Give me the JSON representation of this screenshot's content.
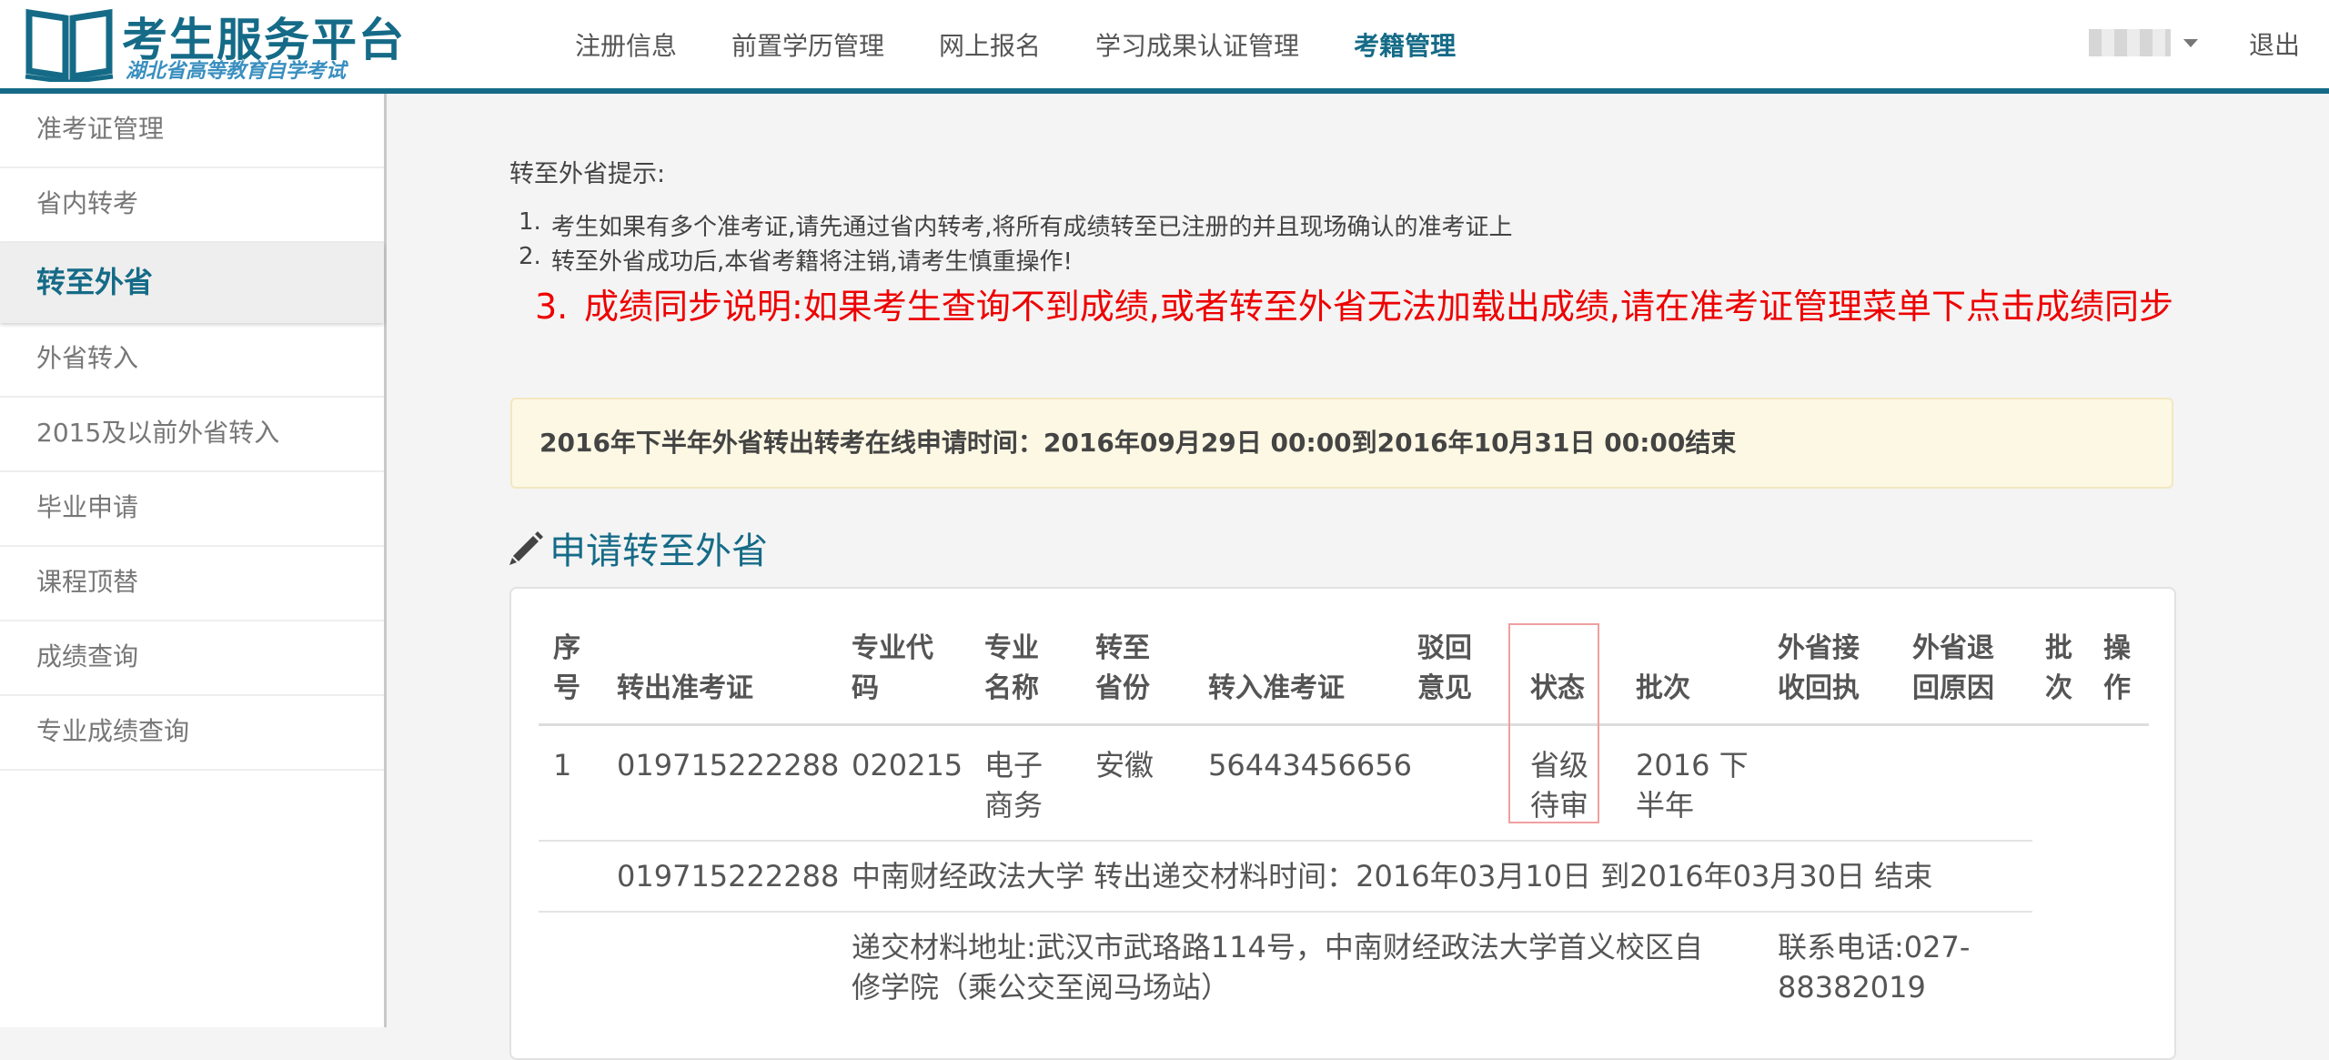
{
  "header": {
    "logo_title": "考生服务平台",
    "logo_subtitle": "湖北省高等教育自学考试",
    "nav": [
      "注册信息",
      "前置学历管理",
      "网上报名",
      "学习成果认证管理",
      "考籍管理"
    ],
    "nav_active_index": 4,
    "logout": "退出"
  },
  "sidebar": {
    "items": [
      {
        "label": "准考证管理"
      },
      {
        "label": "省内转考"
      },
      {
        "label": "转至外省"
      },
      {
        "label": "外省转入"
      },
      {
        "label": "2015及以前外省转入"
      },
      {
        "label": "毕业申请"
      },
      {
        "label": "课程顶替"
      },
      {
        "label": "成绩查询"
      },
      {
        "label": "专业成绩查询"
      }
    ],
    "active_index": 2
  },
  "main": {
    "tips_title": "转至外省提示:",
    "tips": [
      {
        "num": "1.",
        "text": "考生如果有多个准考证,请先通过省内转考,将所有成绩转至已注册的并且现场确认的准考证上"
      },
      {
        "num": "2.",
        "text": "转至外省成功后,本省考籍将注销,请考生慎重操作!"
      },
      {
        "num": "3.",
        "text": "成绩同步说明:如果考生查询不到成绩,或者转至外省无法加载出成绩,请在准考证管理菜单下点击成绩同步"
      }
    ],
    "notice": "2016年下半年外省转出转考在线申请时间：2016年09月29日 00:00到2016年10月31日 00:00结束",
    "section_title": "申请转至外省",
    "table": {
      "headers": [
        "序号",
        "转出准考证",
        "专业代码",
        "专业名称",
        "转至省份",
        "转入准考证",
        "驳回意见",
        "状态",
        "批次",
        "外省接收回执",
        "外省退回原因",
        "批次",
        "操作"
      ],
      "rows": [
        {
          "seq": "1",
          "out_ticket": "019715222288",
          "major_code": "020215",
          "major_name": "电子商务",
          "to_province": "安徽",
          "in_ticket": "56443456656",
          "reject": "",
          "status": "省级待审",
          "batch": "2016 下半年",
          "receipt": "",
          "return_reason": "",
          "batch2": "",
          "operation": ""
        }
      ],
      "detail_ticket": "019715222288",
      "detail_school": "中南财经政法大学 转出递交材料时间：2016年03月10日 到2016年03月30日 结束",
      "detail_address": "递交材料地址:武汉市武珞路114号，中南财经政法大学首义校区自修学院（乘公交至阅马场站）",
      "detail_phone": "联系电话:027-88382019"
    }
  },
  "colors": {
    "brand": "#156b87",
    "warning_text": "#ee0000",
    "notice_bg": "#fcf8e4",
    "status_highlight": "#f0a0a0"
  }
}
